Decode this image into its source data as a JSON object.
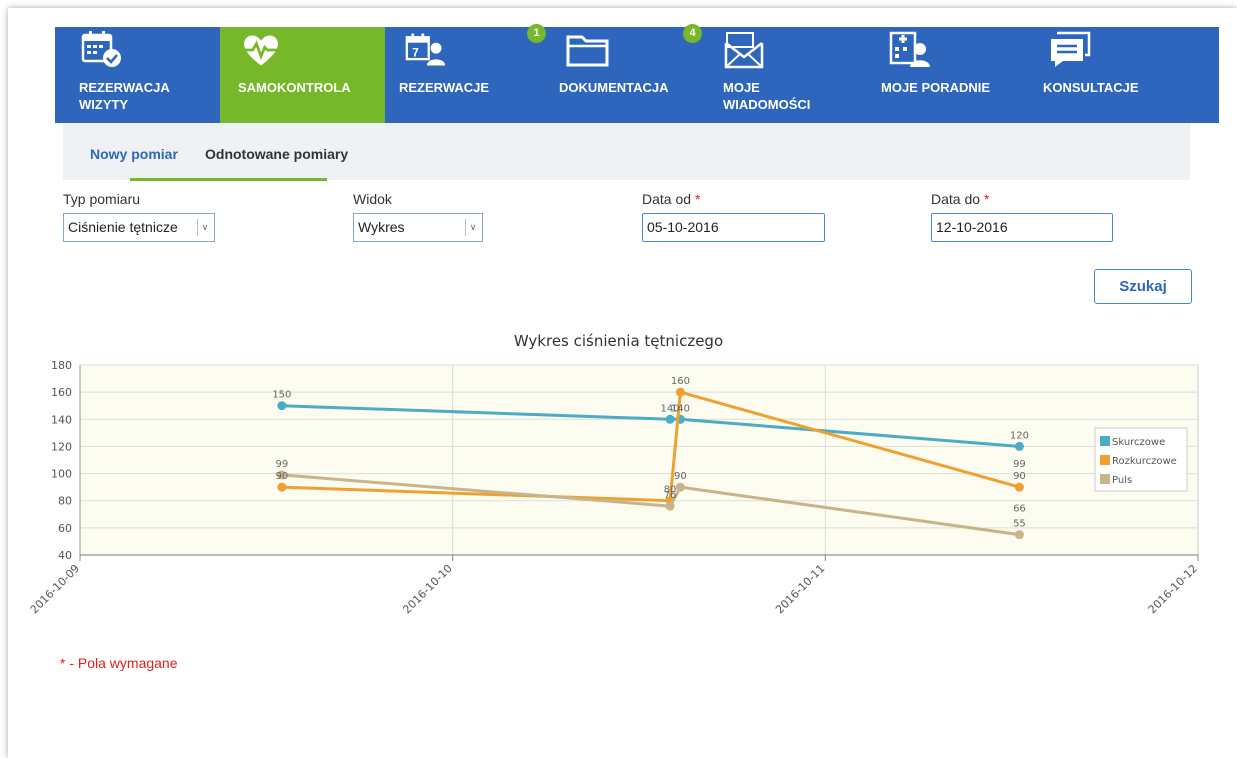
{
  "nav": {
    "items": [
      {
        "label": "REZERWACJA\nWIZYTY",
        "icon": "calendar-check-icon"
      },
      {
        "label": "SAMOKONTROLA",
        "icon": "heart-pulse-icon"
      },
      {
        "label": "REZERWACJE",
        "icon": "calendar-user-icon"
      },
      {
        "label": "DOKUMENTACJA",
        "icon": "folder-icon",
        "badge": "1"
      },
      {
        "label": "MOJE\nWIADOMOŚCI",
        "icon": "envelope-icon",
        "badge": "4"
      },
      {
        "label": "MOJE PORADNIE",
        "icon": "hospital-user-icon"
      },
      {
        "label": "KONSULTACJE",
        "icon": "chat-icon"
      }
    ],
    "active_color": "#76b82a",
    "bg_color": "#2e66bd"
  },
  "subtabs": {
    "nowy": "Nowy pomiar",
    "odnotowane": "Odnotowane pomiary"
  },
  "filters": {
    "typ_label": "Typ pomiaru",
    "typ_value": "Ciśnienie tętnicze",
    "widok_label": "Widok",
    "widok_value": "Wykres",
    "data_od_label": "Data od",
    "data_od_value": "05-10-2016",
    "data_do_label": "Data do",
    "data_do_value": "12-10-2016",
    "required_marker": "*"
  },
  "search_button": "Szukaj",
  "required_note": "* - Pola wymagane",
  "chart_data": {
    "type": "line",
    "title": "Wykres ciśnienia tętniczego",
    "xlabel": "",
    "ylabel": "",
    "x_ticks": [
      "2016-10-09",
      "2016-10-10",
      "2016-10-11",
      "2016-10-12"
    ],
    "x_range_days": [
      0,
      3
    ],
    "ylim": [
      40,
      180
    ],
    "y_ticks": [
      40,
      60,
      80,
      100,
      120,
      140,
      160,
      180
    ],
    "grid": true,
    "legend_position": "right",
    "series": [
      {
        "name": "Skurczowe",
        "color": "#4aacc5",
        "points": [
          {
            "x": "2016-10-09 13:00",
            "y": 150
          },
          {
            "x": "2016-10-10 14:00",
            "y": 140
          },
          {
            "x": "2016-10-10 14:40",
            "y": 140
          },
          {
            "x": "2016-10-11 12:30",
            "y": 120
          }
        ]
      },
      {
        "name": "Rozkurczowe",
        "color": "#f0a030",
        "points": [
          {
            "x": "2016-10-09 13:00",
            "y": 90
          },
          {
            "x": "2016-10-10 14:00",
            "y": 80
          },
          {
            "x": "2016-10-10 14:40",
            "y": 160
          },
          {
            "x": "2016-10-11 12:30",
            "y": 90
          }
        ]
      },
      {
        "name": "Puls",
        "color": "#c8b48a",
        "points": [
          {
            "x": "2016-10-09 13:00",
            "y": 99
          },
          {
            "x": "2016-10-10 14:00",
            "y": 76
          },
          {
            "x": "2016-10-10 14:40",
            "y": 90
          },
          {
            "x": "2016-10-11 12:30",
            "y": 55
          }
        ]
      }
    ],
    "annotations": [
      {
        "text": "150",
        "x": "2016-10-09 13:00",
        "y": 150
      },
      {
        "text": "99",
        "x": "2016-10-09 13:00",
        "y": 99
      },
      {
        "text": "90",
        "x": "2016-10-09 13:00",
        "y": 90
      },
      {
        "text": "140",
        "x": "2016-10-10 14:00",
        "y": 140
      },
      {
        "text": "140",
        "x": "2016-10-10 14:40",
        "y": 140
      },
      {
        "text": "160",
        "x": "2016-10-10 14:40",
        "y": 160
      },
      {
        "text": "90",
        "x": "2016-10-10 14:40",
        "y": 90
      },
      {
        "text": "80",
        "x": "2016-10-10 14:00",
        "y": 80
      },
      {
        "text": "76",
        "x": "2016-10-10 14:00",
        "y": 76
      },
      {
        "text": "120",
        "x": "2016-10-11 12:30",
        "y": 120
      },
      {
        "text": "99",
        "x": "2016-10-11 12:30",
        "y": 99
      },
      {
        "text": "90",
        "x": "2016-10-11 12:30",
        "y": 90
      },
      {
        "text": "66",
        "x": "2016-10-11 12:30",
        "y": 66
      },
      {
        "text": "55",
        "x": "2016-10-11 12:30",
        "y": 55
      }
    ]
  }
}
